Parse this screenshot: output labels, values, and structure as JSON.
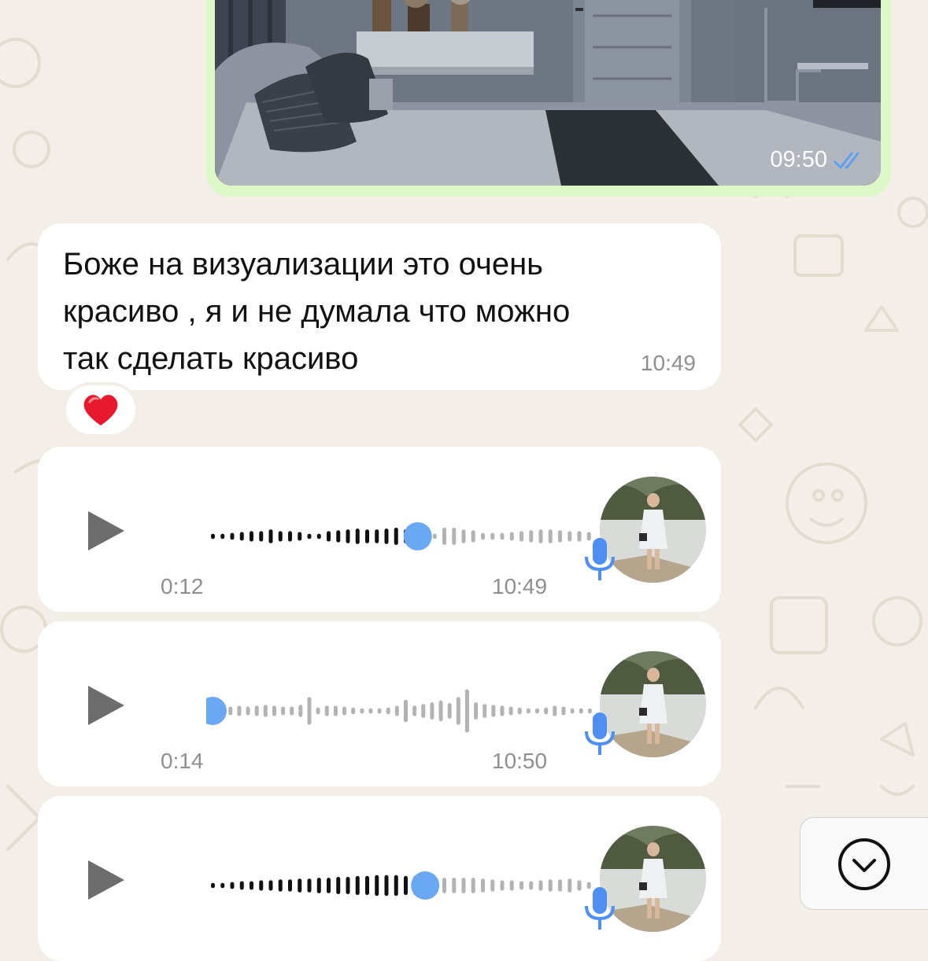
{
  "chat": {
    "photo_message": {
      "time": "09:50",
      "status": "read",
      "icon": "double-check-icon"
    },
    "text_message": {
      "line1": "Боже на визуализации это очень",
      "line2": "красиво , я и не думала что можно",
      "line3": "так сделать красиво",
      "time": "10:49",
      "reaction": "❤️"
    },
    "voice_messages": [
      {
        "duration": "0:12",
        "time": "10:49",
        "progress": 0.55
      },
      {
        "duration": "0:14",
        "time": "10:50",
        "progress": 0.0
      },
      {
        "duration": "",
        "time": "",
        "progress": 0.57
      }
    ]
  },
  "colors": {
    "wallpaper": "#f3efe8",
    "outgoing_bubble": "#dcf8c6",
    "incoming_bubble": "#ffffff",
    "accent_blue": "#6aa8f4",
    "played_wave": "#111111",
    "unplayed_wave": "#b3b3b3"
  },
  "icons": {
    "play": "play-icon",
    "mic": "mic-icon",
    "scroll_down": "chevron-down-circle-icon",
    "heart": "heart-icon"
  }
}
